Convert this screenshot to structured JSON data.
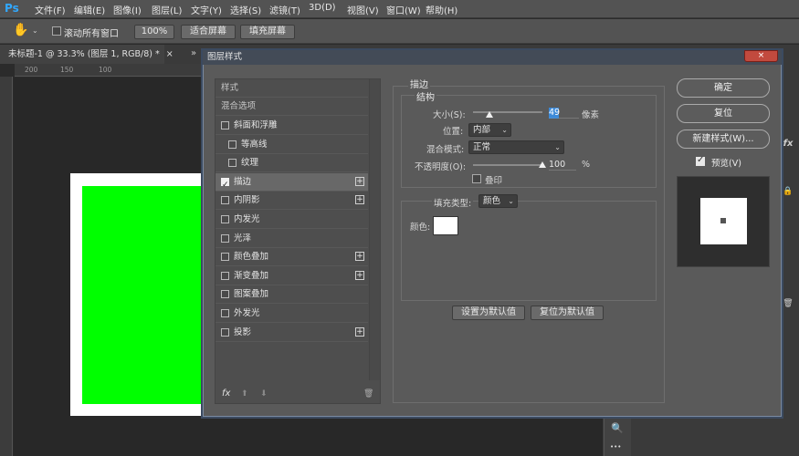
{
  "app": {
    "logo": "Ps",
    "menu": [
      "文件(F)",
      "编辑(E)",
      "图像(I)",
      "图层(L)",
      "文字(Y)",
      "选择(S)",
      "滤镜(T)",
      "3D(D)",
      "视图(V)",
      "窗口(W)",
      "帮助(H)"
    ]
  },
  "options": {
    "scroll_all_label": "滚动所有窗口",
    "zoom_100": "100%",
    "fit_screen": "适合屏幕",
    "fill_screen": "填充屏幕"
  },
  "document": {
    "tab_title": "未标题-1 @ 33.3% (图层 1, RGB/8) *",
    "tab_close": "×",
    "tab_more": "»",
    "ruler_ticks": [
      "200",
      "150",
      "100"
    ]
  },
  "right_panel": {
    "fx_icon": "fx",
    "lock_icon": "🔒",
    "trash_icon": "🗑",
    "search_icon": "🔍",
    "more_icon": "•••"
  },
  "dialog": {
    "title": "图层样式",
    "close": "×",
    "left_list": {
      "style_header": "样式",
      "blend_header": "混合选项",
      "items": [
        {
          "label": "斜面和浮雕",
          "checked": false,
          "plus": false,
          "indent": false
        },
        {
          "label": "等高线",
          "checked": false,
          "plus": false,
          "indent": true
        },
        {
          "label": "纹理",
          "checked": false,
          "plus": false,
          "indent": true
        },
        {
          "label": "描边",
          "checked": true,
          "plus": true,
          "indent": false,
          "active": true
        },
        {
          "label": "内阴影",
          "checked": false,
          "plus": true,
          "indent": false
        },
        {
          "label": "内发光",
          "checked": false,
          "plus": false,
          "indent": false
        },
        {
          "label": "光泽",
          "checked": false,
          "plus": false,
          "indent": false
        },
        {
          "label": "颜色叠加",
          "checked": false,
          "plus": true,
          "indent": false
        },
        {
          "label": "渐变叠加",
          "checked": false,
          "plus": true,
          "indent": false
        },
        {
          "label": "图案叠加",
          "checked": false,
          "plus": false,
          "indent": false
        },
        {
          "label": "外发光",
          "checked": false,
          "plus": false,
          "indent": false
        },
        {
          "label": "投影",
          "checked": false,
          "plus": true,
          "indent": false
        }
      ],
      "footer_fx": "fx",
      "footer_up": "⬆",
      "footer_down": "⬇",
      "footer_trash": "🗑"
    },
    "stroke": {
      "section_title": "描边",
      "structure_title": "结构",
      "size_label": "大小(S):",
      "size_value": "49",
      "size_unit": "像素",
      "position_label": "位置:",
      "position_value": "内部",
      "blend_label": "混合模式:",
      "blend_value": "正常",
      "opacity_label": "不透明度(O):",
      "opacity_value": "100",
      "opacity_unit": "%",
      "emboss_label": "叠印",
      "fill_type_label": "填充类型:",
      "fill_type_value": "颜色",
      "color_label": "颜色:",
      "set_default": "设置为默认值",
      "reset_default": "复位为默认值"
    },
    "buttons": {
      "ok": "确定",
      "reset": "复位",
      "new_style": "新建样式(W)...",
      "preview_label": "预览(V)"
    }
  }
}
